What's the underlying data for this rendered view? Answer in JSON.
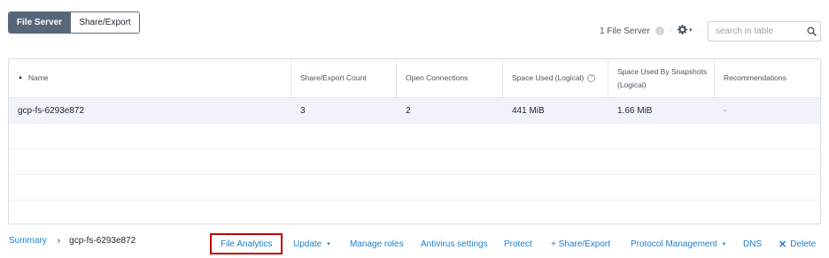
{
  "tabs": {
    "file_server": "File Server",
    "share_export": "Share/Export"
  },
  "toolbar": {
    "count_text": "1 File Server",
    "search_placeholder": "search in table"
  },
  "table": {
    "columns": [
      "Name",
      "Share/Export Count",
      "Open Connections",
      "Space Used (Logical)",
      "Space Used By Snapshots (Logical)",
      "Recommendations"
    ],
    "rows": [
      [
        "gcp-fs-6293e872",
        "3",
        "2",
        "441 MiB",
        "1.66 MiB",
        "-"
      ]
    ]
  },
  "breadcrumb": {
    "summary": "Summary",
    "separator": "›",
    "current": "gcp-fs-6293e872"
  },
  "actions": {
    "file_analytics": "File Analytics",
    "update": "Update",
    "manage_roles": "Manage roles",
    "antivirus_settings": "Antivirus settings",
    "protect": "Protect",
    "share_export": "+ Share/Export",
    "protocol_management": "Protocol Management",
    "dns": "DNS",
    "delete": "Delete"
  },
  "icons": {
    "sort": "sort-ascending-icon",
    "info": "info-icon",
    "gear": "gear-icon",
    "search": "search-icon",
    "delete": "x-icon"
  },
  "colors": {
    "accent": "#1b7fd1",
    "active_tab": "#56677a",
    "highlight_border": "#c00000",
    "selected_row": "#f0f4fa"
  }
}
